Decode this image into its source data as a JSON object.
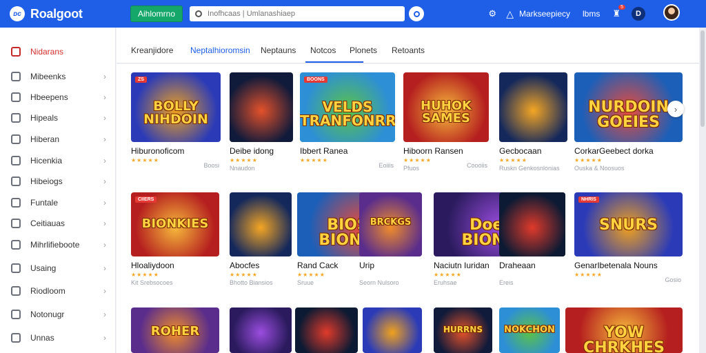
{
  "brand": {
    "logo_text": "ᴅᴄ",
    "name": "Roalgoot"
  },
  "topbar": {
    "cta_label": "Aihlomrno",
    "search_placeholder": "Inofhcaas | Umlanashiaep",
    "marketplace_label": "Markseepiecy",
    "link_label": "lbms",
    "badge": "5",
    "profile_initial": "D"
  },
  "sidebar": {
    "items": [
      {
        "label": "Nidarans",
        "active": true,
        "icon": "grid-icon"
      },
      {
        "label": "Mibeenks",
        "icon": "list-icon"
      },
      {
        "label": "Hbeepens",
        "icon": "user-icon"
      },
      {
        "label": "Hipeals",
        "icon": "document-icon"
      },
      {
        "label": "Hiberan",
        "icon": "calendar-icon"
      },
      {
        "label": "Hicenkia",
        "icon": "chart-icon"
      },
      {
        "label": "Hibeiogs",
        "icon": "folder-icon"
      },
      {
        "label": "Funtale",
        "icon": "check-icon"
      },
      {
        "label": "Ceitiauas",
        "icon": "cube-icon"
      },
      {
        "label": "Mihrlifieboote",
        "icon": "layers-icon"
      },
      {
        "label": "Usaing",
        "icon": "tag-icon"
      },
      {
        "label": "Riodloom",
        "icon": "puzzle-icon"
      },
      {
        "label": "Notonugr",
        "icon": "heart-icon"
      },
      {
        "label": "Unnas",
        "icon": "info-icon"
      }
    ]
  },
  "tabs": [
    {
      "label": "Kreanjidore",
      "active": false
    },
    {
      "label": "Neptalhioromsin",
      "active": true
    },
    {
      "label": "Neptauns",
      "active": false
    },
    {
      "label": "Notcos",
      "active": false
    },
    {
      "label": "Plonets",
      "active": false
    },
    {
      "label": "Retoants",
      "active": false
    }
  ],
  "rows": [
    {
      "cards": [
        {
          "art": "BOLLY NIHDOIN",
          "tag": "ZS",
          "title": "Hiburonoficom",
          "stars": "★★★★★",
          "meta": "",
          "meta_right": "Boosi"
        },
        {
          "art": "",
          "tag": "",
          "title": "Deibe idong",
          "stars": "★★★★★",
          "meta": "Nnaudon",
          "meta_right": ""
        },
        {
          "art": "VELDS TRANFONRRNS",
          "tag": "BOONS",
          "title": "Ibbert Ranea",
          "stars": "★★★★★",
          "meta": "",
          "meta_right": "Eoiiis"
        },
        {
          "art": "HUHOK SAMES",
          "tag": "",
          "title": "Hiboorn Ransen",
          "stars": "★★★★★",
          "meta": "Pfuos",
          "meta_right": "Coooiis"
        },
        {
          "art": "",
          "tag": "",
          "title": "Gecbocaan",
          "stars": "★★★★★",
          "meta": "Ruskn Genkosnlonias",
          "meta_right": ""
        },
        {
          "art": "NURDOIN GOEIES",
          "tag": "",
          "title": "CorkarGeebect dorka",
          "stars": "★★★★★",
          "meta": "Ouska & Noosuos",
          "meta_right": ""
        }
      ]
    },
    {
      "cards": [
        {
          "art": "BIONKIES",
          "tag": "CIIERS",
          "title": "Hloaliydoon",
          "stars": "★★★★★",
          "meta": "Kit Srebsocoes",
          "meta_right": ""
        },
        {
          "art": "",
          "tag": "",
          "title": "Abocfes",
          "stars": "★★★★★",
          "meta": "Bhotto Biansios",
          "meta_right": ""
        },
        {
          "art": "BIOSOP BIONKIES",
          "tag": "",
          "title": "Rand Cack",
          "stars": "★★★★★",
          "meta": "Sruue",
          "meta_right": ""
        },
        {
          "art": "BRCKGS",
          "tag": "",
          "title": "Urip",
          "stars": "",
          "meta": "Seorn Nulsoro",
          "meta_right": ""
        },
        {
          "art": "Doetes BIONKES",
          "tag": "",
          "title": "Naciutn Iuridan",
          "stars": "★★★★★",
          "meta": "Eruhsae",
          "meta_right": ""
        },
        {
          "art": "",
          "tag": "",
          "title": "Draheaan",
          "stars": "",
          "meta": "Ereis",
          "meta_right": ""
        },
        {
          "art": "SNURS",
          "tag": "NHRIS",
          "title": "GenarIbetenala Nouns",
          "stars": "★★★★★",
          "meta": "",
          "meta_right": "Gosio"
        }
      ]
    },
    {
      "cards": [
        {
          "art": "ROHER",
          "tag": ""
        },
        {
          "art": "",
          "tag": ""
        },
        {
          "art": "",
          "tag": ""
        },
        {
          "art": "",
          "tag": ""
        },
        {
          "art": "HURRNS",
          "tag": ""
        },
        {
          "art": "NOKCHON",
          "tag": ""
        },
        {
          "art": "YOW CHRKHES",
          "tag": ""
        }
      ]
    }
  ],
  "colors": {
    "topbar": "#1f5fe8",
    "cta": "#15a66a",
    "active_tab": "#1f5fe8",
    "active_sidebar": "#d32f2f",
    "stars": "#f5a623"
  }
}
